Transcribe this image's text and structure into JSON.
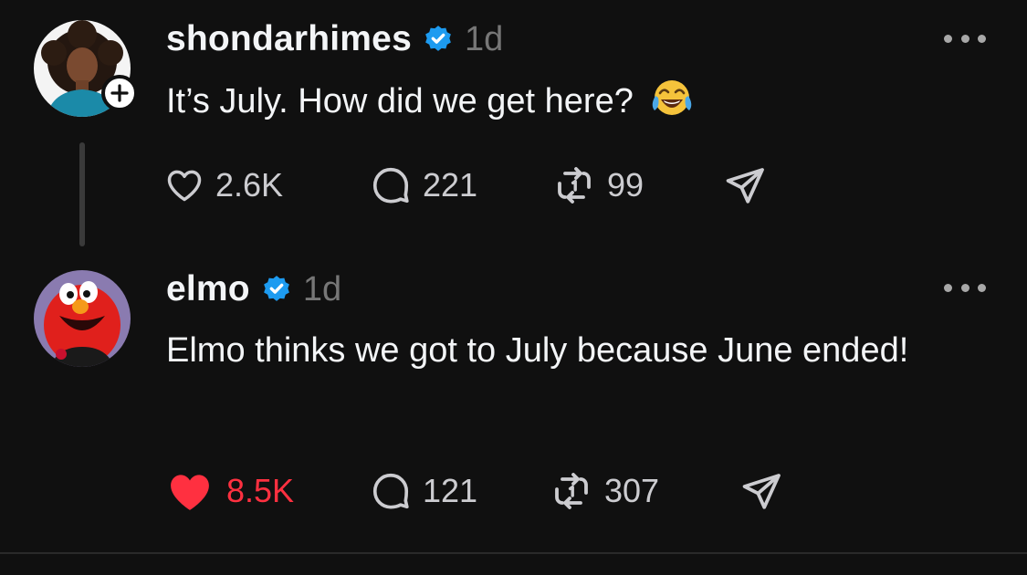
{
  "colors": {
    "background": "#101010",
    "text": "#f3f5f7",
    "muted": "#777777",
    "verified": "#1d9bf0",
    "like_active": "#ff3040"
  },
  "posts": [
    {
      "username": "shondarhimes",
      "verified": true,
      "time": "1d",
      "text": "It’s July. How did we get here?",
      "emoji": "face-with-tears-of-joy",
      "has_follow_button": true,
      "liked": false,
      "likes": "2.6K",
      "replies": "221",
      "reposts": "99"
    },
    {
      "username": "elmo",
      "verified": true,
      "time": "1d",
      "text": "Elmo thinks we got to July because June ended!",
      "liked": true,
      "likes": "8.5K",
      "replies": "121",
      "reposts": "307"
    }
  ],
  "icons": {
    "more": "more-horizontal-icon",
    "like": "heart-icon",
    "reply": "speech-bubble-icon",
    "repost": "repost-icon",
    "share": "send-icon",
    "verified": "verified-badge-icon",
    "follow": "plus-icon"
  }
}
